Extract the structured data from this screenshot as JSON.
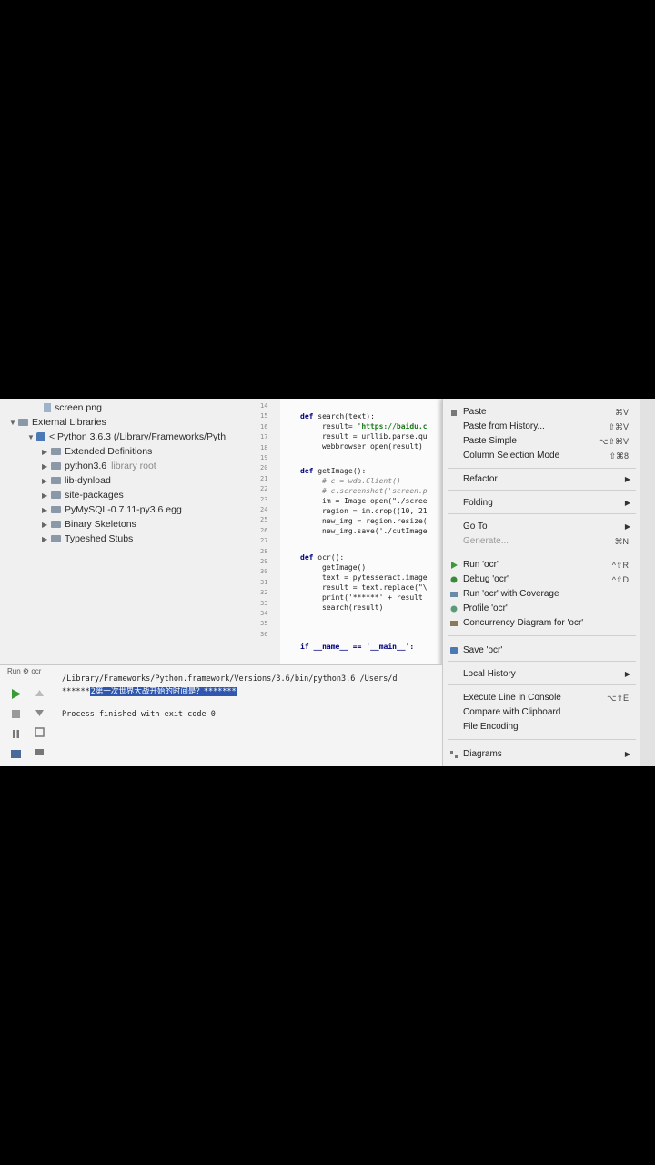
{
  "tree": {
    "screen_file": "screen.png",
    "external_libraries": "External Libraries",
    "python_sdk": "< Python 3.6.3 (/Library/Frameworks/Pyth",
    "children": [
      {
        "label": "Extended Definitions",
        "extra": ""
      },
      {
        "label": "python3.6",
        "extra": "library root"
      },
      {
        "label": "lib-dynload",
        "extra": ""
      },
      {
        "label": "site-packages",
        "extra": ""
      },
      {
        "label": "PyMySQL-0.7.11-py3.6.egg",
        "extra": ""
      },
      {
        "label": "Binary Skeletons",
        "extra": ""
      },
      {
        "label": "Typeshed Stubs",
        "extra": ""
      }
    ]
  },
  "gutter": [
    "14",
    "15",
    "16",
    "17",
    "18",
    "19",
    "20",
    "21",
    "22",
    "23",
    "24",
    "25",
    "26",
    "27",
    "28",
    "29",
    "30",
    "31",
    "32",
    "33",
    "34",
    "35",
    "36"
  ],
  "code": {
    "l15": "search(text):",
    "l16a": "result= ",
    "l16b": "'https://baidu.c",
    "l17": "result = urllib.parse.qu",
    "l18": "webbrowser.open(result)",
    "l20": "getImage():",
    "l21": "# c = wda.Client()",
    "l22": "# c.screenshot('screen.p",
    "l23": "im = Image.open(\"./scree",
    "l24": "region = im.crop((10, 21",
    "l25": "new_img = region.resize(",
    "l26": "new_img.save('./cutImage",
    "l28": "ocr():",
    "l29": "getImage()",
    "l30": "text = pytesseract.image",
    "l31": "result = text.replace(\"\\",
    "l32": "print('******' + result",
    "l33": "search(result)",
    "l36": "if __name__ == '__main__':",
    "kw_def": "def"
  },
  "menu": {
    "items": [
      {
        "label": "Paste",
        "shortcut": "⌘V"
      },
      {
        "label": "Paste from History...",
        "shortcut": "⇧⌘V"
      },
      {
        "label": "Paste Simple",
        "shortcut": "⌥⇧⌘V"
      },
      {
        "label": "Column Selection Mode",
        "shortcut": "⇧⌘8"
      },
      {
        "label": "Refactor",
        "shortcut": ""
      },
      {
        "label": "Folding",
        "shortcut": ""
      },
      {
        "label": "Go To",
        "shortcut": ""
      },
      {
        "label": "Generate...",
        "shortcut": "⌘N"
      },
      {
        "label": "Run 'ocr'",
        "shortcut": "^⇧R"
      },
      {
        "label": "Debug 'ocr'",
        "shortcut": "^⇧D"
      },
      {
        "label": "Run 'ocr' with Coverage",
        "shortcut": ""
      },
      {
        "label": "Profile 'ocr'",
        "shortcut": ""
      },
      {
        "label": "Concurrency Diagram for 'ocr'",
        "shortcut": ""
      },
      {
        "label": "Save 'ocr'",
        "shortcut": ""
      },
      {
        "label": "Local History",
        "shortcut": ""
      },
      {
        "label": "Execute Line in Console",
        "shortcut": "⌥⇧E"
      },
      {
        "label": "Compare with Clipboard",
        "shortcut": ""
      },
      {
        "label": "File Encoding",
        "shortcut": ""
      },
      {
        "label": "Diagrams",
        "shortcut": ""
      }
    ]
  },
  "run": {
    "title": "Run",
    "config": "ocr",
    "cmd": "/Library/Frameworks/Python.framework/Versions/3.6/bin/python3.6 /Users/d",
    "output_prefix": "******",
    "output_highlight": "2第一次世界大战开始的时间是？*******",
    "finished": "Process finished with exit code 0"
  },
  "colors": {
    "selection": "#2f57b0",
    "keyword": "#000080",
    "string": "#1a7a1a",
    "run_green": "#3a9a3a"
  }
}
